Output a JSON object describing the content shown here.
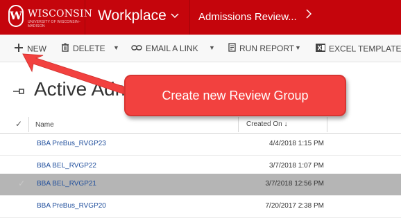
{
  "header": {
    "logo_text": "WISCONSIN",
    "logo_subtext": "UNIVERSITY OF WISCONSIN–MADISON",
    "logo_crest": "W",
    "app_name": "Workplace",
    "breadcrumb": "Admissions Review..."
  },
  "toolbar": {
    "new_label": "NEW",
    "delete_label": "DELETE",
    "email_label": "EMAIL A LINK",
    "report_label": "RUN REPORT",
    "excel_label": "EXCEL TEMPLATES"
  },
  "view": {
    "title": "Active Adm"
  },
  "grid": {
    "columns": {
      "name": "Name",
      "created": "Created On ↓"
    },
    "rows": [
      {
        "name": "BBA PreBus_RVGP23",
        "created": "4/4/2018  1:15 PM"
      },
      {
        "name": "BBA BEL_RVGP22",
        "created": "3/7/2018  1:07 PM"
      },
      {
        "name": "BBA BEL_RVGP21",
        "created": "3/7/2018 12:56 PM"
      },
      {
        "name": "BBA PreBus_RVGP20",
        "created": "7/20/2017  2:38 PM"
      }
    ]
  },
  "callout": {
    "text": "Create new Review Group"
  },
  "colors": {
    "brand_red": "#c5050c",
    "callout_red": "#f2413f",
    "link_blue": "#1f4e9c",
    "selected_row": "#b5b5b5"
  },
  "icons": [
    "plus-icon",
    "trash-icon",
    "link-icon",
    "report-icon",
    "excel-icon",
    "pin-icon",
    "checkmark-icon",
    "chevron-down-icon",
    "chevron-right-icon"
  ]
}
